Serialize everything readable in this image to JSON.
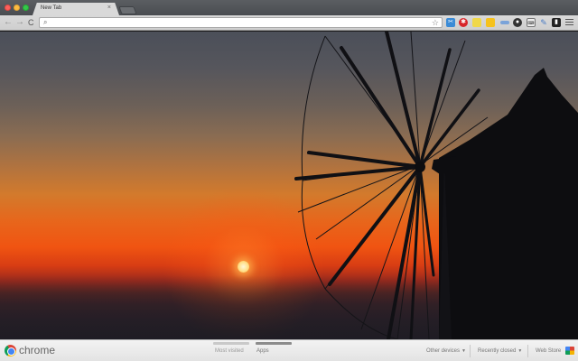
{
  "window": {
    "tab_title": "New Tab",
    "tab_close_glyph": "×"
  },
  "toolbar": {
    "back_glyph": "←",
    "forward_glyph": "→",
    "reload_glyph": "C",
    "search_glyph": "⌕",
    "omnibox_value": "",
    "star_glyph": "☆",
    "extensions": [
      {
        "icon": "bookmark-extension-icon",
        "color": "#3b8bd6"
      },
      {
        "icon": "red-extension-icon",
        "color": "#d8262a"
      },
      {
        "icon": "yellow-note-extension-icon",
        "color": "#f0d84a"
      },
      {
        "icon": "sticky-extension-icon",
        "color": "#f6c21c"
      },
      {
        "icon": "blue-bar-extension-icon",
        "color": "#7aa3d9"
      },
      {
        "icon": "circle-extension-icon",
        "color": "#333333"
      },
      {
        "icon": "keyboard-extension-icon",
        "color": "#eeeeee"
      },
      {
        "icon": "pin-extension-icon",
        "color": "#4a7cc4"
      },
      {
        "icon": "dark-square-extension-icon",
        "color": "#222222"
      }
    ]
  },
  "footer": {
    "brand": "chrome",
    "tabs": [
      "Most visited",
      "Apps"
    ],
    "active_tab": "Apps",
    "other_devices": "Other devices",
    "recently_closed": "Recently closed",
    "web_store": "Web Store"
  }
}
